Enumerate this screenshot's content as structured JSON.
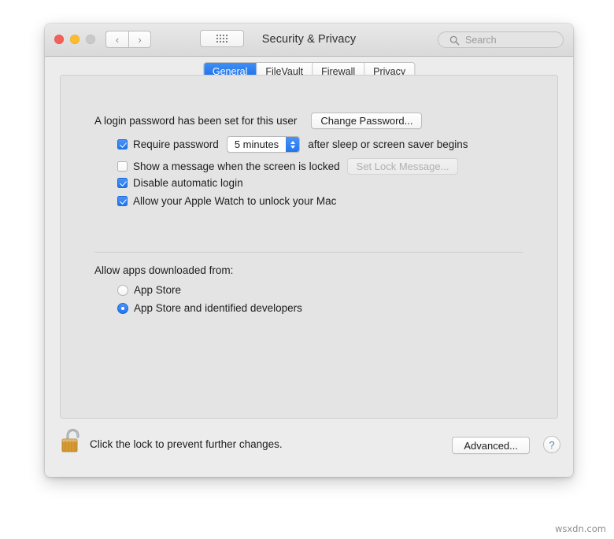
{
  "window": {
    "title": "Security & Privacy",
    "traffic_lights": [
      "close",
      "minimize",
      "zoom"
    ],
    "nav_back_glyph": "‹",
    "nav_forward_glyph": "›",
    "show_all_icon": "grid-icon"
  },
  "search": {
    "placeholder": "Search",
    "icon": "search-icon"
  },
  "tabs": [
    {
      "label": "General",
      "active": true
    },
    {
      "label": "FileVault",
      "active": false
    },
    {
      "label": "Firewall",
      "active": false
    },
    {
      "label": "Privacy",
      "active": false
    }
  ],
  "general": {
    "password_status": "A login password has been set for this user",
    "change_password_label": "Change Password...",
    "require_password": {
      "label": "Require password",
      "checked": true,
      "interval_value": "5 minutes",
      "suffix": "after sleep or screen saver begins"
    },
    "lock_message": {
      "label": "Show a message when the screen is locked",
      "checked": false,
      "button_label": "Set Lock Message...",
      "button_disabled": true
    },
    "disable_auto_login": {
      "label": "Disable automatic login",
      "checked": true
    },
    "apple_watch": {
      "label": "Allow your Apple Watch to unlock your Mac",
      "checked": true
    },
    "gatekeeper": {
      "heading": "Allow apps downloaded from:",
      "options": [
        {
          "label": "App Store",
          "selected": false
        },
        {
          "label": "App Store and identified developers",
          "selected": true
        }
      ]
    }
  },
  "footer": {
    "lock_icon": "unlocked-padlock-icon",
    "lock_text": "Click the lock to prevent further changes.",
    "advanced_label": "Advanced...",
    "help_label": "?"
  },
  "watermark": "wsxdn.com",
  "colors": {
    "accent_blue": "#2176ef",
    "tab_active_blue": "#1a6de8",
    "lock_gold": "#d79a32",
    "window_bg": "#ececec",
    "panel_bg": "#e4e4e4"
  }
}
